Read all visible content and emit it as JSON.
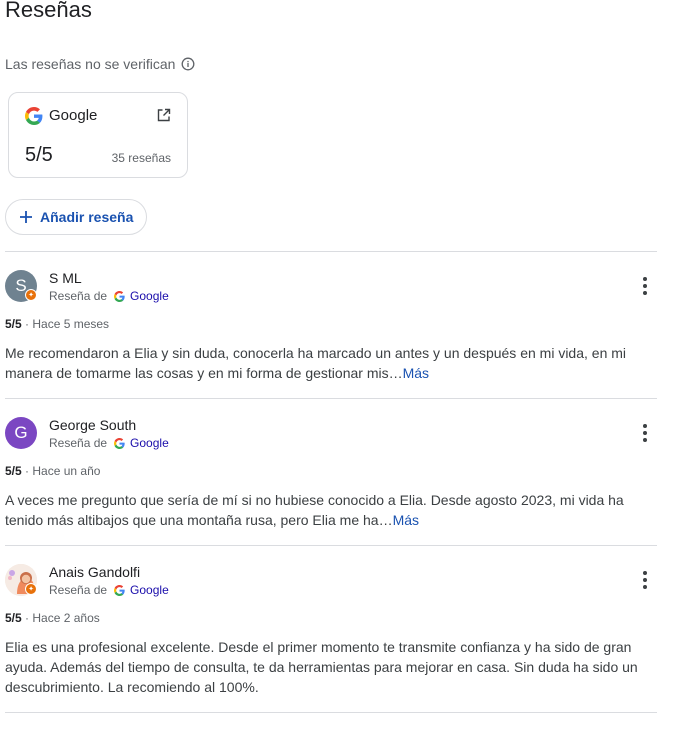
{
  "section": {
    "title": "Reseñas",
    "verify_note": "Las reseñas no se verifican"
  },
  "google_card": {
    "name": "Google",
    "rating": "5/5",
    "count": "35 reseñas"
  },
  "add_review": {
    "label": "Añadir reseña"
  },
  "colors": {
    "accent": "#1a52b0",
    "avatar_s": "#6f8290",
    "avatar_g": "#7b47c2",
    "badge": "#e8710a"
  },
  "reviews": [
    {
      "initial": "S",
      "name": "S ML",
      "source_prefix": "Reseña de",
      "source": "Google",
      "rating": "5/5",
      "time": "· Hace 5 meses",
      "text": "Me recomendaron a Elia y sin duda, conocerla ha marcado un antes y un después en mi vida, en mi manera de tomarme las cosas y en mi forma de gestionar mis…",
      "more": "Más"
    },
    {
      "initial": "G",
      "name": "George South",
      "source_prefix": "Reseña de",
      "source": "Google",
      "rating": "5/5",
      "time": "· Hace un año",
      "text": "A veces me pregunto que sería de mí si no hubiese conocido a Elia. Desde agosto 2023, mi vida ha tenido más altibajos que una montaña rusa, pero Elia me ha…",
      "more": "Más"
    },
    {
      "name": "Anais Gandolfi",
      "source_prefix": "Reseña de",
      "source": "Google",
      "rating": "5/5",
      "time": "· Hace 2 años",
      "text": "Elia es una profesional excelente. Desde el primer momento te transmite confianza y ha sido de gran ayuda. Además del tiempo de consulta, te da herramientas para mejorar en casa. Sin duda ha sido un descubrimiento. La recomiendo al 100%."
    }
  ]
}
